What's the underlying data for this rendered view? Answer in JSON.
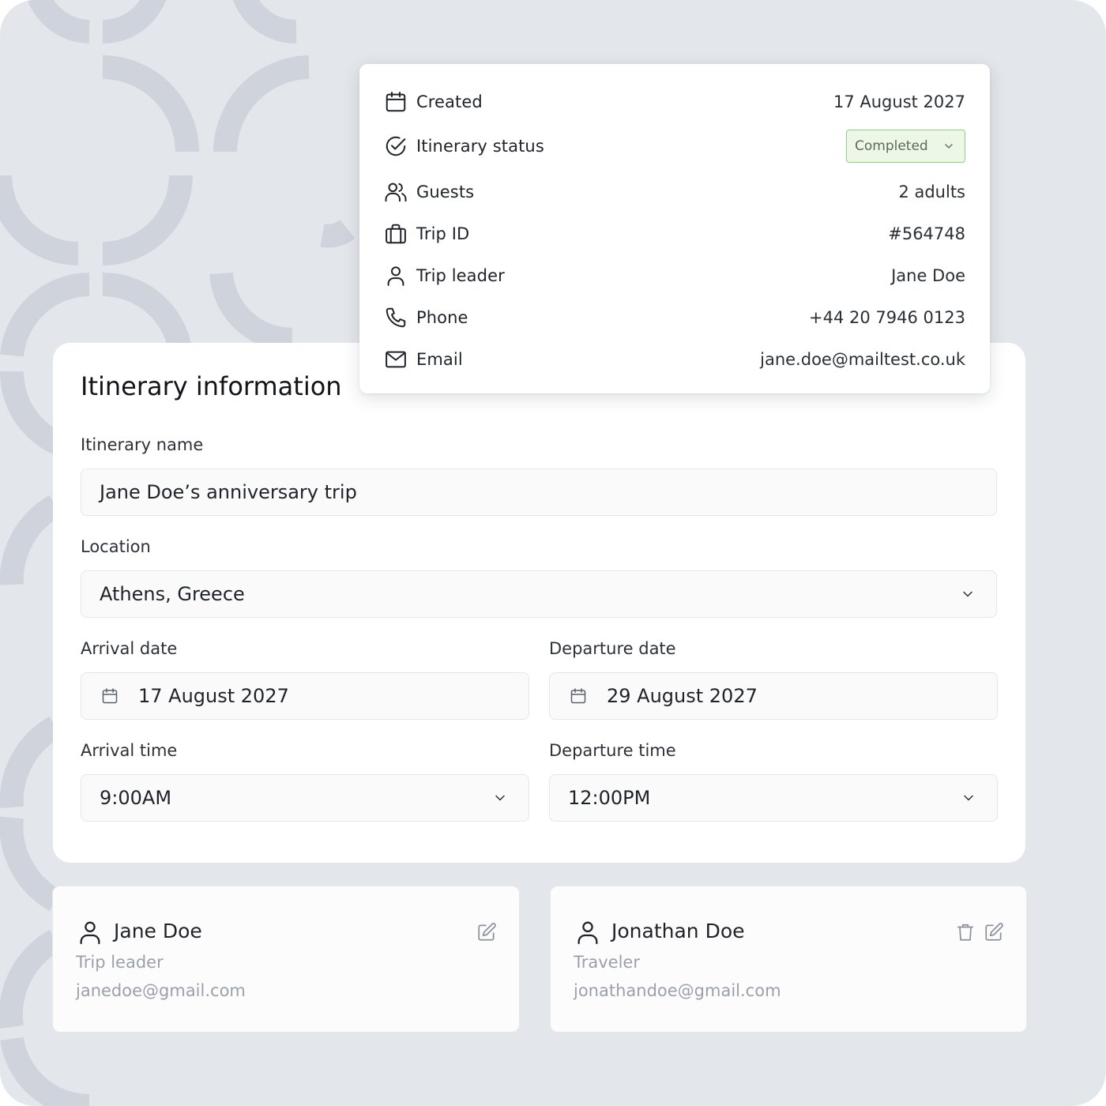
{
  "summary": {
    "rows": [
      {
        "icon": "calendar-icon",
        "label": "Created",
        "value": "17 August 2027"
      },
      {
        "icon": "check-circle-icon",
        "label": "Itinerary status",
        "value": "Completed"
      },
      {
        "icon": "users-icon",
        "label": "Guests",
        "value": "2 adults"
      },
      {
        "icon": "luggage-icon",
        "label": "Trip ID",
        "value": "#564748"
      },
      {
        "icon": "user-icon",
        "label": "Trip leader",
        "value": "Jane Doe"
      },
      {
        "icon": "phone-icon",
        "label": "Phone",
        "value": "+44 20 7946 0123"
      },
      {
        "icon": "mail-icon",
        "label": "Email",
        "value": "jane.doe@mailtest.co.uk"
      }
    ],
    "status_colors": {
      "border": "#8fcf84",
      "background": "#ecf7e8"
    }
  },
  "form": {
    "title": "Itinerary information",
    "itinerary_name": {
      "label": "Itinerary name",
      "value": "Jane Doe’s anniversary trip"
    },
    "location": {
      "label": "Location",
      "value": "Athens, Greece"
    },
    "arrival_date": {
      "label": "Arrival date",
      "value": "17 August 2027"
    },
    "departure_date": {
      "label": "Departure date",
      "value": "29 August 2027"
    },
    "arrival_time": {
      "label": "Arrival time",
      "value": "9:00AM"
    },
    "departure_time": {
      "label": "Departure time",
      "value": "12:00PM"
    }
  },
  "people": [
    {
      "name": "Jane Doe",
      "role": "Trip leader",
      "email": "janedoe@gmail.com",
      "actions": [
        "edit-icon"
      ]
    },
    {
      "name": "Jonathan Doe",
      "role": "Traveler",
      "email": "jonathandoe@gmail.com",
      "actions": [
        "trash-icon",
        "edit-icon"
      ]
    }
  ]
}
